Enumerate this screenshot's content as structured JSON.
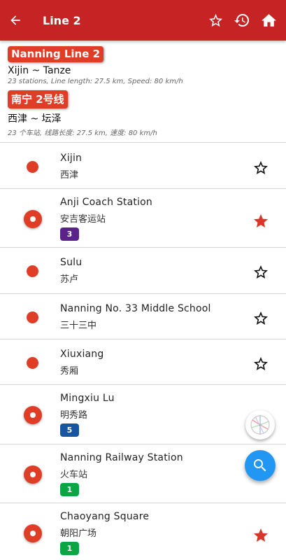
{
  "appbar": {
    "title": "Line 2",
    "icons": [
      "back-arrow-icon",
      "star-outline-icon",
      "history-icon",
      "home-icon"
    ],
    "color": "#c62325"
  },
  "line_info": {
    "en_name": "Nanning Line 2",
    "en_route": "Xijin ~ Tanze",
    "en_meta": "23 stations, Line length: 27.5 km, Speed: 80 km/h",
    "cn_name": "南宁 2号线",
    "cn_route": "西津 ~ 坛泽",
    "cn_meta": "23 个车站, 线路长度: 27.5 km, 速度: 80 km/h",
    "line_color": "#e03d26"
  },
  "stations": [
    {
      "name": "Xijin",
      "cn": "西津",
      "transfer": null,
      "favorite": false
    },
    {
      "name": "Anji Coach Station",
      "cn": "安吉客运站",
      "transfer": {
        "label": "3",
        "color": "#5b2289"
      },
      "favorite": true
    },
    {
      "name": "Sulu",
      "cn": "苏卢",
      "transfer": null,
      "favorite": false
    },
    {
      "name": "Nanning No. 33 Middle School",
      "cn": "三十三中",
      "transfer": null,
      "favorite": false
    },
    {
      "name": "Xiuxiang",
      "cn": "秀厢",
      "transfer": null,
      "favorite": false
    },
    {
      "name": "Mingxiu Lu",
      "cn": "明秀路",
      "transfer": {
        "label": "5",
        "color": "#1755a0"
      },
      "favorite": false
    },
    {
      "name": "Nanning Railway Station",
      "cn": "火车站",
      "transfer": {
        "label": "1",
        "color": "#0ca543"
      },
      "favorite": false
    },
    {
      "name": "Chaoyang Square",
      "cn": "朝阳广场",
      "transfer": {
        "label": "1",
        "color": "#0ca543"
      },
      "favorite": true
    }
  ],
  "fabs": {
    "map_icon": "metro-map-icon",
    "search_icon": "search-icon",
    "search_color": "#2196f3"
  }
}
